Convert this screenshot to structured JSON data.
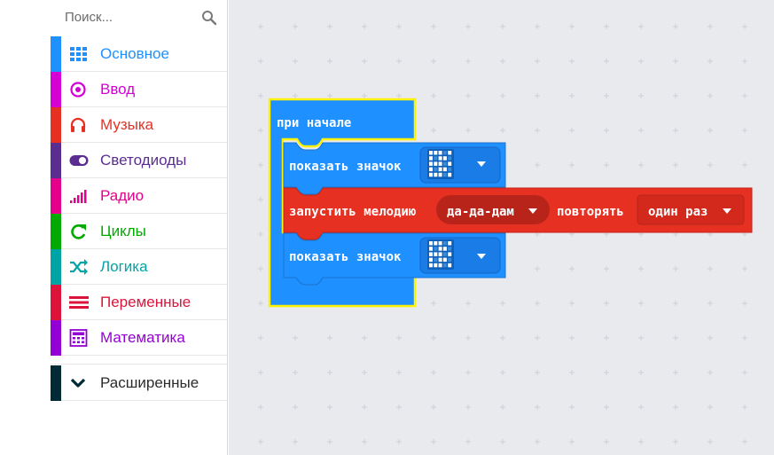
{
  "search": {
    "placeholder": "Поиск..."
  },
  "toolbox": {
    "categories": [
      {
        "label": "Основное",
        "color": "#1E90FF",
        "icon": "grid-icon"
      },
      {
        "label": "Ввод",
        "color": "#D400D4",
        "icon": "circle-target-icon"
      },
      {
        "label": "Музыка",
        "color": "#E63022",
        "icon": "headphones-icon"
      },
      {
        "label": "Светодиоды",
        "color": "#5C2D91",
        "icon": "toggle-icon"
      },
      {
        "label": "Радио",
        "color": "#E3008C",
        "icon": "signal-bars-icon"
      },
      {
        "label": "Циклы",
        "color": "#00AA00",
        "icon": "loop-icon"
      },
      {
        "label": "Логика",
        "color": "#00A4A6",
        "icon": "shuffle-icon"
      },
      {
        "label": "Переменные",
        "color": "#DC143C",
        "icon": "lines-icon"
      },
      {
        "label": "Математика",
        "color": "#9400D3",
        "icon": "calculator-icon"
      }
    ],
    "advanced": {
      "label": "Расширенные",
      "color": "#002B36",
      "icon": "chevron-down-icon"
    }
  },
  "blocks": {
    "on_start": {
      "label": "при начале",
      "color": "#1E90FF"
    },
    "show_icon_1": {
      "label": "показать значок",
      "color": "#1E90FF"
    },
    "play_melody": {
      "label": "запустить мелодию",
      "melody": "да-да-дам",
      "repeat_label": "повторять",
      "repeat": "один раз",
      "color": "#E63022"
    },
    "show_icon_2": {
      "label": "показать значок",
      "color": "#1E90FF"
    }
  }
}
